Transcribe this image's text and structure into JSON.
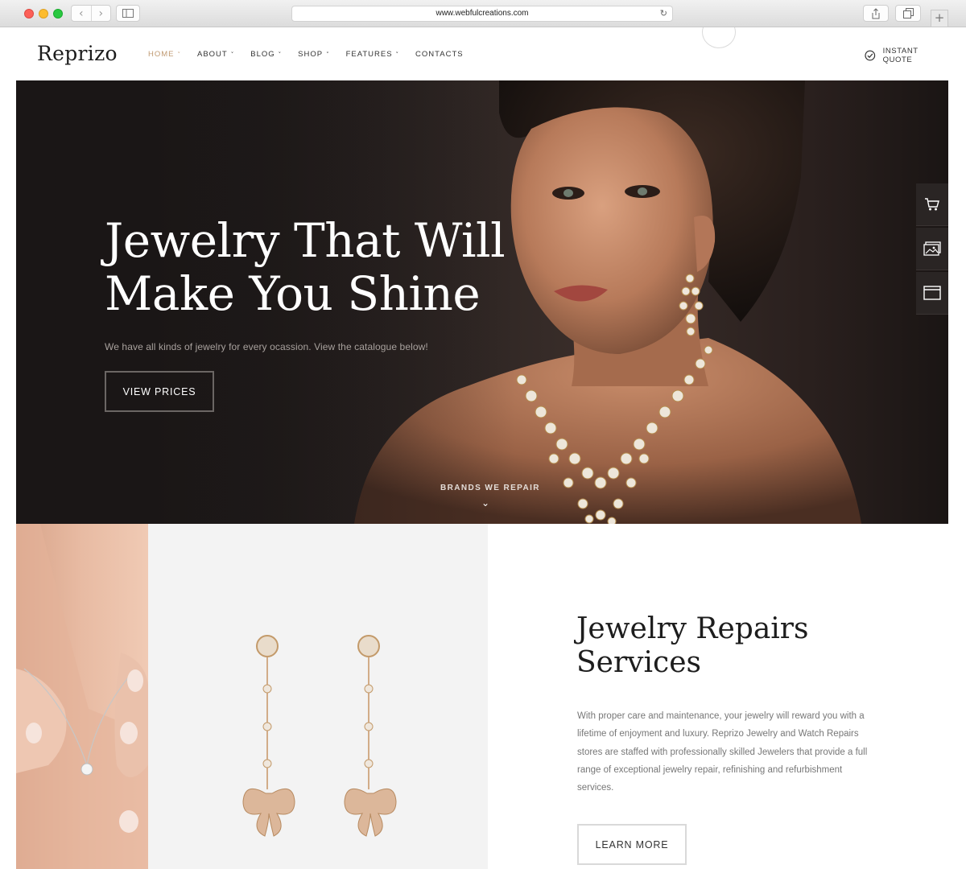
{
  "browser": {
    "url": "www.webfulcreations.com",
    "back_glyph": "‹",
    "forward_glyph": "›",
    "reload_glyph": "↻",
    "newtab_glyph": "+"
  },
  "header": {
    "logo": "Reprizo",
    "menu": [
      {
        "label": "HOME",
        "chevron": "˅",
        "active": true
      },
      {
        "label": "ABOUT",
        "chevron": "˅",
        "active": false
      },
      {
        "label": "BLOG",
        "chevron": "˅",
        "active": false
      },
      {
        "label": "SHOP",
        "chevron": "˅",
        "active": false
      },
      {
        "label": "FEATURES",
        "chevron": "˅",
        "active": false
      },
      {
        "label": "CONTACTS",
        "chevron": "",
        "active": false
      }
    ],
    "quote_label": "INSTANT QUOTE",
    "quote_icon": "check-circle-icon"
  },
  "hero": {
    "title_line1": "Jewelry That Will",
    "title_line2": "Make You Shine",
    "subtitle": "We have all kinds of jewelry for every ocassion. View the catalogue below!",
    "button_label": "VIEW PRICES",
    "scroll_label": "BRANDS WE REPAIR",
    "scroll_chevron": "⌄"
  },
  "side_tools": [
    {
      "icon": "cart-icon"
    },
    {
      "icon": "photo-icon"
    },
    {
      "icon": "browser-window-icon"
    }
  ],
  "repairs": {
    "title_line1": "Jewelry Repairs",
    "title_line2": "Services",
    "body": "With proper care and maintenance, your jewelry will reward you with a lifetime of enjoyment and luxury. Reprizo Jewelry and Watch Repairs stores are staffed with professionally skilled Jewelers that provide a full range of exceptional jewelry repair, refinishing and refurbishment services.",
    "button_label": "LEARN MORE"
  },
  "colors": {
    "accent": "#c09a72",
    "hero_bg": "#201b1a",
    "text_dark": "#1d1d1d",
    "text_muted": "#777777"
  }
}
